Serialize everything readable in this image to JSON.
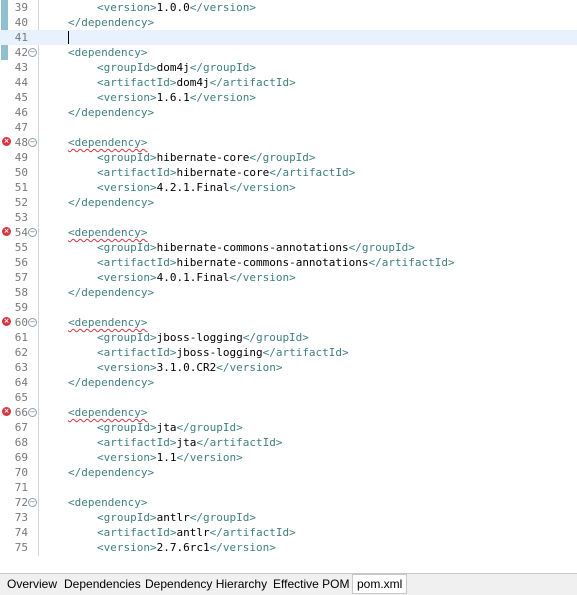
{
  "lines": [
    {
      "n": "39",
      "indent": 1,
      "parts": [
        [
          "tag",
          "<version>"
        ],
        [
          "txt",
          "1.0.0"
        ],
        [
          "tag",
          "</version>"
        ]
      ]
    },
    {
      "n": "40",
      "indent": 0,
      "parts": [
        [
          "tag",
          "</dependency>"
        ]
      ]
    },
    {
      "n": "41",
      "indent": 0,
      "parts": [],
      "current": true
    },
    {
      "n": "42",
      "indent": 0,
      "fold": true,
      "parts": [
        [
          "tag",
          "<dependency>"
        ]
      ]
    },
    {
      "n": "43",
      "indent": 1,
      "parts": [
        [
          "tag",
          "<groupId>"
        ],
        [
          "txt",
          "dom4j"
        ],
        [
          "tag",
          "</groupId>"
        ]
      ]
    },
    {
      "n": "44",
      "indent": 1,
      "parts": [
        [
          "tag",
          "<artifactId>"
        ],
        [
          "txt",
          "dom4j"
        ],
        [
          "tag",
          "</artifactId>"
        ]
      ]
    },
    {
      "n": "45",
      "indent": 1,
      "parts": [
        [
          "tag",
          "<version>"
        ],
        [
          "txt",
          "1.6.1"
        ],
        [
          "tag",
          "</version>"
        ]
      ]
    },
    {
      "n": "46",
      "indent": 0,
      "parts": [
        [
          "tag",
          "</dependency>"
        ]
      ]
    },
    {
      "n": "47",
      "indent": 0,
      "parts": []
    },
    {
      "n": "48",
      "indent": 0,
      "fold": true,
      "error": true,
      "parts": [
        [
          "tag squig",
          "<dependency>"
        ]
      ]
    },
    {
      "n": "49",
      "indent": 1,
      "parts": [
        [
          "tag",
          "<groupId>"
        ],
        [
          "txt",
          "hibernate-core"
        ],
        [
          "tag",
          "</groupId>"
        ]
      ]
    },
    {
      "n": "50",
      "indent": 1,
      "parts": [
        [
          "tag",
          "<artifactId>"
        ],
        [
          "txt",
          "hibernate-core"
        ],
        [
          "tag",
          "</artifactId>"
        ]
      ]
    },
    {
      "n": "51",
      "indent": 1,
      "parts": [
        [
          "tag",
          "<version>"
        ],
        [
          "txt",
          "4.2.1.Final"
        ],
        [
          "tag",
          "</version>"
        ]
      ]
    },
    {
      "n": "52",
      "indent": 0,
      "parts": [
        [
          "tag",
          "</dependency>"
        ]
      ]
    },
    {
      "n": "53",
      "indent": 0,
      "parts": []
    },
    {
      "n": "54",
      "indent": 0,
      "fold": true,
      "error": true,
      "parts": [
        [
          "tag squig",
          "<dependency>"
        ]
      ]
    },
    {
      "n": "55",
      "indent": 1,
      "parts": [
        [
          "tag",
          "<groupId>"
        ],
        [
          "txt",
          "hibernate-commons-annotations"
        ],
        [
          "tag",
          "</groupId>"
        ]
      ]
    },
    {
      "n": "56",
      "indent": 1,
      "parts": [
        [
          "tag",
          "<artifactId>"
        ],
        [
          "txt",
          "hibernate-commons-annotations"
        ],
        [
          "tag",
          "</artifactId>"
        ]
      ]
    },
    {
      "n": "57",
      "indent": 1,
      "parts": [
        [
          "tag",
          "<version>"
        ],
        [
          "txt",
          "4.0.1.Final"
        ],
        [
          "tag",
          "</version>"
        ]
      ]
    },
    {
      "n": "58",
      "indent": 0,
      "parts": [
        [
          "tag",
          "</dependency>"
        ]
      ]
    },
    {
      "n": "59",
      "indent": 0,
      "parts": []
    },
    {
      "n": "60",
      "indent": 0,
      "fold": true,
      "error": true,
      "parts": [
        [
          "tag squig",
          "<dependency>"
        ]
      ]
    },
    {
      "n": "61",
      "indent": 1,
      "parts": [
        [
          "tag",
          "<groupId>"
        ],
        [
          "txt",
          "jboss-logging"
        ],
        [
          "tag",
          "</groupId>"
        ]
      ]
    },
    {
      "n": "62",
      "indent": 1,
      "parts": [
        [
          "tag",
          "<artifactId>"
        ],
        [
          "txt",
          "jboss-logging"
        ],
        [
          "tag",
          "</artifactId>"
        ]
      ]
    },
    {
      "n": "63",
      "indent": 1,
      "parts": [
        [
          "tag",
          "<version>"
        ],
        [
          "txt",
          "3.1.0.CR2"
        ],
        [
          "tag",
          "</version>"
        ]
      ]
    },
    {
      "n": "64",
      "indent": 0,
      "parts": [
        [
          "tag",
          "</dependency>"
        ]
      ]
    },
    {
      "n": "65",
      "indent": 0,
      "parts": []
    },
    {
      "n": "66",
      "indent": 0,
      "fold": true,
      "error": true,
      "parts": [
        [
          "tag squig",
          "<dependency>"
        ]
      ]
    },
    {
      "n": "67",
      "indent": 1,
      "parts": [
        [
          "tag",
          "<groupId>"
        ],
        [
          "txt",
          "jta"
        ],
        [
          "tag",
          "</groupId>"
        ]
      ]
    },
    {
      "n": "68",
      "indent": 1,
      "parts": [
        [
          "tag",
          "<artifactId>"
        ],
        [
          "txt",
          "jta"
        ],
        [
          "tag",
          "</artifactId>"
        ]
      ]
    },
    {
      "n": "69",
      "indent": 1,
      "parts": [
        [
          "tag",
          "<version>"
        ],
        [
          "txt",
          "1.1"
        ],
        [
          "tag",
          "</version>"
        ]
      ]
    },
    {
      "n": "70",
      "indent": 0,
      "parts": [
        [
          "tag",
          "</dependency>"
        ]
      ]
    },
    {
      "n": "71",
      "indent": 0,
      "parts": []
    },
    {
      "n": "72",
      "indent": 0,
      "fold": true,
      "parts": [
        [
          "tag",
          "<dependency>"
        ]
      ]
    },
    {
      "n": "73",
      "indent": 1,
      "parts": [
        [
          "tag",
          "<groupId>"
        ],
        [
          "txt",
          "antlr"
        ],
        [
          "tag",
          "</groupId>"
        ]
      ]
    },
    {
      "n": "74",
      "indent": 1,
      "parts": [
        [
          "tag",
          "<artifactId>"
        ],
        [
          "txt",
          "antlr"
        ],
        [
          "tag",
          "</artifactId>"
        ]
      ]
    },
    {
      "n": "75",
      "indent": 1,
      "parts": [
        [
          "tag",
          "<version>"
        ],
        [
          "txt",
          "2.7.6rc1"
        ],
        [
          "tag",
          "</version>"
        ]
      ]
    }
  ],
  "tabs": [
    {
      "label": "Overview"
    },
    {
      "label": "Dependencies"
    },
    {
      "label": "Dependency Hierarchy"
    },
    {
      "label": "Effective POM"
    },
    {
      "label": "pom.xml",
      "active": true
    }
  ],
  "colors": {
    "tag": "#3f7f7f",
    "text": "#000000",
    "current_line": "#e8f2fe",
    "error": "#d9333f"
  }
}
